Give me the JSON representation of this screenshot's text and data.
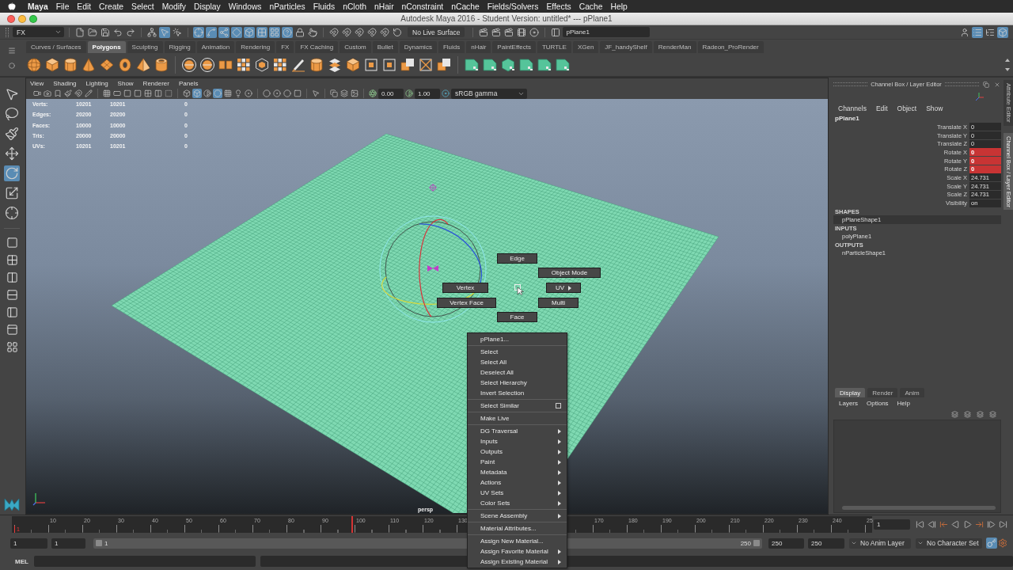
{
  "menu_bar": {
    "app": "Maya",
    "items": [
      "File",
      "Edit",
      "Create",
      "Select",
      "Modify",
      "Display",
      "Windows",
      "nParticles",
      "Fluids",
      "nCloth",
      "nHair",
      "nConstraint",
      "nCache",
      "Fields/Solvers",
      "Effects",
      "Cache",
      "Help"
    ]
  },
  "window": {
    "title": "Autodesk Maya 2016 - Student Version: untitled* --- pPlane1"
  },
  "status_line": {
    "menu_set": "FX",
    "select_modes": [
      {
        "on": false
      },
      {
        "on": true
      },
      {
        "on": false
      }
    ],
    "selection_masks": [
      {
        "on": true
      },
      {
        "on": true
      },
      {
        "on": true
      },
      {
        "on": true
      },
      {
        "on": true
      },
      {
        "on": true
      },
      {
        "on": true
      },
      {
        "on": true
      }
    ],
    "live_surface": "No Live Surface",
    "name_field": "pPlane1",
    "panel_toggles": [
      {
        "on": false
      },
      {
        "on": true
      },
      {
        "on": false
      },
      {
        "on": true
      }
    ]
  },
  "shelf": {
    "tabs": [
      {
        "label": "Curves / Surfaces",
        "selected": false
      },
      {
        "label": "Polygons",
        "selected": true
      },
      {
        "label": "Sculpting",
        "selected": false
      },
      {
        "label": "Rigging",
        "selected": false
      },
      {
        "label": "Animation",
        "selected": false
      },
      {
        "label": "Rendering",
        "selected": false
      },
      {
        "label": "FX",
        "selected": false
      },
      {
        "label": "FX Caching",
        "selected": false
      },
      {
        "label": "Custom",
        "selected": false
      },
      {
        "label": "Bullet",
        "selected": false
      },
      {
        "label": "Dynamics",
        "selected": false
      },
      {
        "label": "Fluids",
        "selected": false
      },
      {
        "label": "nHair",
        "selected": false
      },
      {
        "label": "PaintEffects",
        "selected": false
      },
      {
        "label": "TURTLE",
        "selected": false
      },
      {
        "label": "XGen",
        "selected": false
      },
      {
        "label": "JF_handyShelf",
        "selected": false
      },
      {
        "label": "RenderMan",
        "selected": false
      },
      {
        "label": "Radeon_ProRender",
        "selected": false
      }
    ]
  },
  "toolbox": {
    "tools": [
      {
        "selected": false
      },
      {
        "selected": false
      },
      {
        "selected": false
      },
      {
        "selected": false
      },
      {
        "selected": true
      },
      {
        "selected": false
      },
      {
        "selected": false
      }
    ]
  },
  "viewport": {
    "menu": [
      "View",
      "Shading",
      "Lighting",
      "Show",
      "Renderer",
      "Panels"
    ],
    "toolbar": [
      {
        "on": false
      },
      {
        "on": false
      },
      {
        "on": false
      },
      {
        "on": false
      },
      {
        "on": false
      },
      {
        "on": false
      },
      {
        "on": false
      },
      {
        "on": false
      },
      {
        "on": false
      },
      {
        "on": false
      },
      {
        "on": false
      },
      {
        "on": false
      },
      {
        "on": false
      },
      {
        "on": false
      },
      {
        "on": true
      },
      {
        "on": false
      },
      {
        "on": true
      },
      {
        "on": false
      },
      {
        "on": false
      },
      {
        "on": false
      },
      {
        "on": false
      },
      {
        "on": false
      },
      {
        "on": false
      },
      {
        "on": false
      },
      {
        "on": false
      },
      {
        "on": false
      },
      {
        "on": false
      },
      {
        "on": false
      }
    ],
    "exposure": "0.00",
    "gamma": "1.00",
    "color_space": "sRGB gamma",
    "hud": [
      {
        "label": "Verts:",
        "values": [
          "10201",
          "10201",
          "0"
        ]
      },
      {
        "label": "Edges:",
        "values": [
          "20200",
          "20200",
          "0"
        ]
      },
      {
        "label": "Faces:",
        "values": [
          "10000",
          "10000",
          "0"
        ]
      },
      {
        "label": "Tris:",
        "values": [
          "20000",
          "20000",
          "0"
        ]
      },
      {
        "label": "UVs:",
        "values": [
          "10201",
          "10201",
          "0"
        ]
      }
    ],
    "camera": "persp",
    "marking_menu": [
      {
        "label": "Edge",
        "submenu": false
      },
      {
        "label": "Object Mode",
        "submenu": false
      },
      {
        "label": "UV",
        "submenu": true
      },
      {
        "label": "Multi",
        "submenu": false
      },
      {
        "label": "Face",
        "submenu": false
      },
      {
        "label": "Vertex Face",
        "submenu": false
      },
      {
        "label": "Vertex",
        "submenu": false
      }
    ]
  },
  "context_menu": {
    "groups": [
      [
        {
          "label": "pPlane1...",
          "submenu": false,
          "option_box": false
        }
      ],
      [
        {
          "label": "Select",
          "submenu": false,
          "option_box": false
        },
        {
          "label": "Select All",
          "submenu": false,
          "option_box": false
        },
        {
          "label": "Deselect All",
          "submenu": false,
          "option_box": false
        },
        {
          "label": "Select Hierarchy",
          "submenu": false,
          "option_box": false
        },
        {
          "label": "Invert Selection",
          "submenu": false,
          "option_box": false
        }
      ],
      [
        {
          "label": "Select Similar",
          "submenu": false,
          "option_box": true
        }
      ],
      [
        {
          "label": "Make Live",
          "submenu": false,
          "option_box": false
        }
      ],
      [
        {
          "label": "DG Traversal",
          "submenu": true,
          "option_box": false
        },
        {
          "label": "Inputs",
          "submenu": true,
          "option_box": false
        },
        {
          "label": "Outputs",
          "submenu": true,
          "option_box": false
        },
        {
          "label": "Paint",
          "submenu": true,
          "option_box": false
        },
        {
          "label": "Metadata",
          "submenu": true,
          "option_box": false
        },
        {
          "label": "Actions",
          "submenu": true,
          "option_box": false
        },
        {
          "label": "UV Sets",
          "submenu": true,
          "option_box": false
        },
        {
          "label": "Color Sets",
          "submenu": true,
          "option_box": false
        }
      ],
      [
        {
          "label": "Scene Assembly",
          "submenu": true,
          "option_box": false
        }
      ],
      [
        {
          "label": "Material Attributes...",
          "submenu": false,
          "option_box": false
        }
      ],
      [
        {
          "label": "Assign New Material...",
          "submenu": false,
          "option_box": false
        },
        {
          "label": "Assign Favorite Material",
          "submenu": true,
          "option_box": false
        },
        {
          "label": "Assign Existing Material",
          "submenu": true,
          "option_box": false
        }
      ]
    ]
  },
  "channel_box": {
    "title": "Channel Box / Layer Editor",
    "menu": [
      "Channels",
      "Edit",
      "Object",
      "Show"
    ],
    "object": "pPlane1",
    "channels": [
      {
        "name": "Translate X",
        "value": "0",
        "keyed": false
      },
      {
        "name": "Translate Y",
        "value": "0",
        "keyed": false
      },
      {
        "name": "Translate Z",
        "value": "0",
        "keyed": false
      },
      {
        "name": "Rotate X",
        "value": "0",
        "keyed": true
      },
      {
        "name": "Rotate Y",
        "value": "0",
        "keyed": true
      },
      {
        "name": "Rotate Z",
        "value": "0",
        "keyed": true
      },
      {
        "name": "Scale X",
        "value": "24.731",
        "keyed": false
      },
      {
        "name": "Scale Y",
        "value": "24.731",
        "keyed": false
      },
      {
        "name": "Scale Z",
        "value": "24.731",
        "keyed": false
      },
      {
        "name": "Visibility",
        "value": "on",
        "keyed": false
      }
    ],
    "sections": [
      {
        "heading": "SHAPES",
        "nodes": [
          {
            "label": "pPlaneShape1",
            "selected": true
          }
        ]
      },
      {
        "heading": "INPUTS",
        "nodes": [
          {
            "label": "polyPlane1",
            "selected": false
          }
        ]
      },
      {
        "heading": "OUTPUTS",
        "nodes": [
          {
            "label": "nParticleShape1",
            "selected": false
          }
        ]
      }
    ]
  },
  "layer_editor": {
    "tabs": [
      {
        "label": "Display",
        "selected": true
      },
      {
        "label": "Render",
        "selected": false
      },
      {
        "label": "Anim",
        "selected": false
      }
    ],
    "menu": [
      "Layers",
      "Options",
      "Help"
    ]
  },
  "side_tabs": [
    {
      "label": "Attribute Editor",
      "selected": false
    },
    {
      "label": "Channel Box / Layer Editor",
      "selected": true
    }
  ],
  "time_slider": {
    "playhead": {
      "label": "1",
      "level": 0
    },
    "key": {
      "level": 0.395
    },
    "labels_start": [
      "10",
      "20",
      "30",
      "40",
      "50",
      "60",
      "70",
      "80",
      "90",
      "100",
      "110",
      "120",
      "130"
    ],
    "labels_end": [
      "170",
      "180",
      "190",
      "200",
      "210",
      "220",
      "230",
      "240",
      "25"
    ],
    "current_frame": "1"
  },
  "range_slider": {
    "start": "1",
    "range_start": "1",
    "handle_start": "1",
    "handle_end": "250",
    "range_end": "250",
    "end": "250",
    "anim_layer": "No Anim Layer",
    "character_set": "No Character Set",
    "toggles": [
      {
        "on": true
      },
      {
        "on": false
      }
    ]
  },
  "command_line": {
    "language": "MEL"
  }
}
